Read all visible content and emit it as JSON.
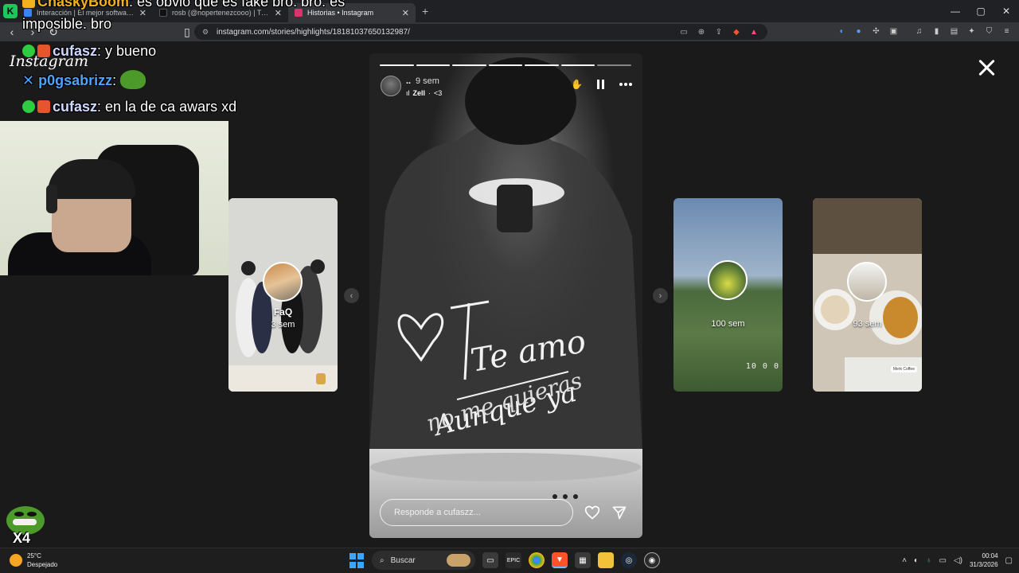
{
  "browser": {
    "tabs": [
      {
        "label": "Interacción | El mejor software para",
        "favicon_color": "#3b82f6",
        "active": false
      },
      {
        "label": "rosb (@nopertenezcooo) | TikTok",
        "favicon_color": "#111111",
        "active": false
      },
      {
        "label": "Historias • Instagram",
        "favicon_color": "#e1306c",
        "active": true
      }
    ],
    "new_tab": "+",
    "window_controls": {
      "minimize": "—",
      "maximize": "▢",
      "close": "✕"
    },
    "url": "instagram.com/stories/highlights/18181037650132987/"
  },
  "instagram": {
    "logo": "Instagram",
    "previews": [
      {
        "name": "FaQ",
        "time": "3 sem"
      },
      {
        "time": "100 sem",
        "stamp": "10 0 0"
      },
      {
        "time": "93 sem",
        "tag": "Merk Coffee"
      }
    ],
    "story": {
      "username": "..",
      "time": "9 sem",
      "music_artist": "Zell",
      "music_sep": "·",
      "music_title": "<3",
      "segments_total": 7,
      "segments_done": 6,
      "handwriting": [
        "Te amo",
        "Aunque ya",
        "no me quieras"
      ],
      "reply_placeholder": "Responde a cufaszz..."
    }
  },
  "chat": {
    "lines": [
      {
        "user": "ChaskyBoom",
        "text": ": es obvio que es fake bro. bro. es"
      },
      {
        "user": "",
        "text": "imposible. bro"
      },
      {
        "user": "cufasz",
        "text": ": y bueno"
      },
      {
        "user": "p0gsabrizz",
        "text": ":"
      },
      {
        "user": "cufasz",
        "text": ": en la de ca awars xd"
      }
    ],
    "emote_multiplier": "X4"
  },
  "taskbar": {
    "temperature": "25°C",
    "weather": "Despejado",
    "search_label": "Buscar",
    "time": "00:04",
    "date": "31/3/2026"
  }
}
